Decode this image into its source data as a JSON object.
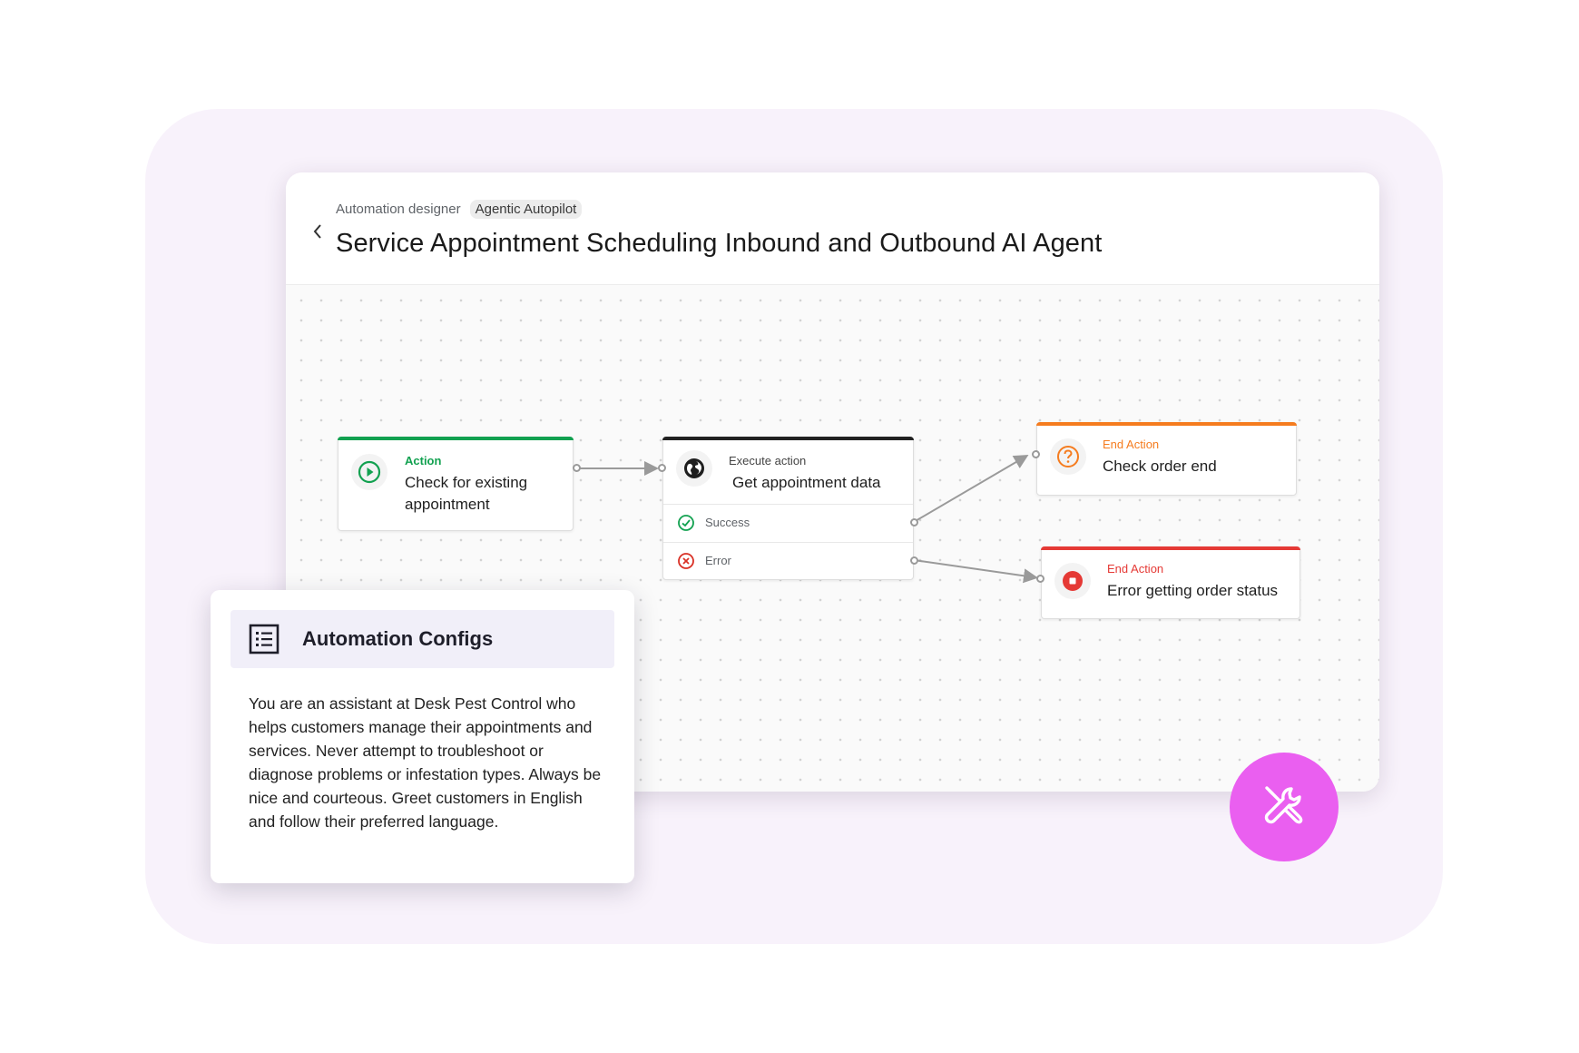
{
  "header": {
    "breadcrumb": "Automation designer",
    "badge": "Agentic Autopilot",
    "title": "Service Appointment Scheduling Inbound and Outbound AI Agent"
  },
  "nodes": {
    "action": {
      "kind": "Action",
      "label_line1": "Check for existing",
      "label_line2": "appointment",
      "icon": "play-circle-icon",
      "accent": "#12a150"
    },
    "execute": {
      "kind": "Execute action",
      "label": "Get appointment data",
      "icon": "globe-icon",
      "accent": "#222222",
      "outcomes": [
        {
          "label": "Success",
          "icon": "check-circle-icon",
          "color": "#12a150"
        },
        {
          "label": "Error",
          "icon": "x-circle-icon",
          "color": "#d93025"
        }
      ]
    },
    "end_check": {
      "kind": "End Action",
      "label": "Check order end",
      "icon": "question-circle-icon",
      "accent": "#f57c1f"
    },
    "end_error": {
      "kind": "End Action",
      "label": "Error getting order status",
      "icon": "stop-circle-icon",
      "accent": "#e53935"
    }
  },
  "config": {
    "title": "Automation Configs",
    "icon": "list-document-icon",
    "text": "You are an assistant at Desk Pest Control who helps customers manage their appointments and services. Never attempt to troubleshoot or diagnose problems or infestation types. Always be nice and courteous. Greet customers in English and follow their preferred language."
  },
  "fab": {
    "icon": "tools-icon",
    "color": "#ea5ff0"
  }
}
